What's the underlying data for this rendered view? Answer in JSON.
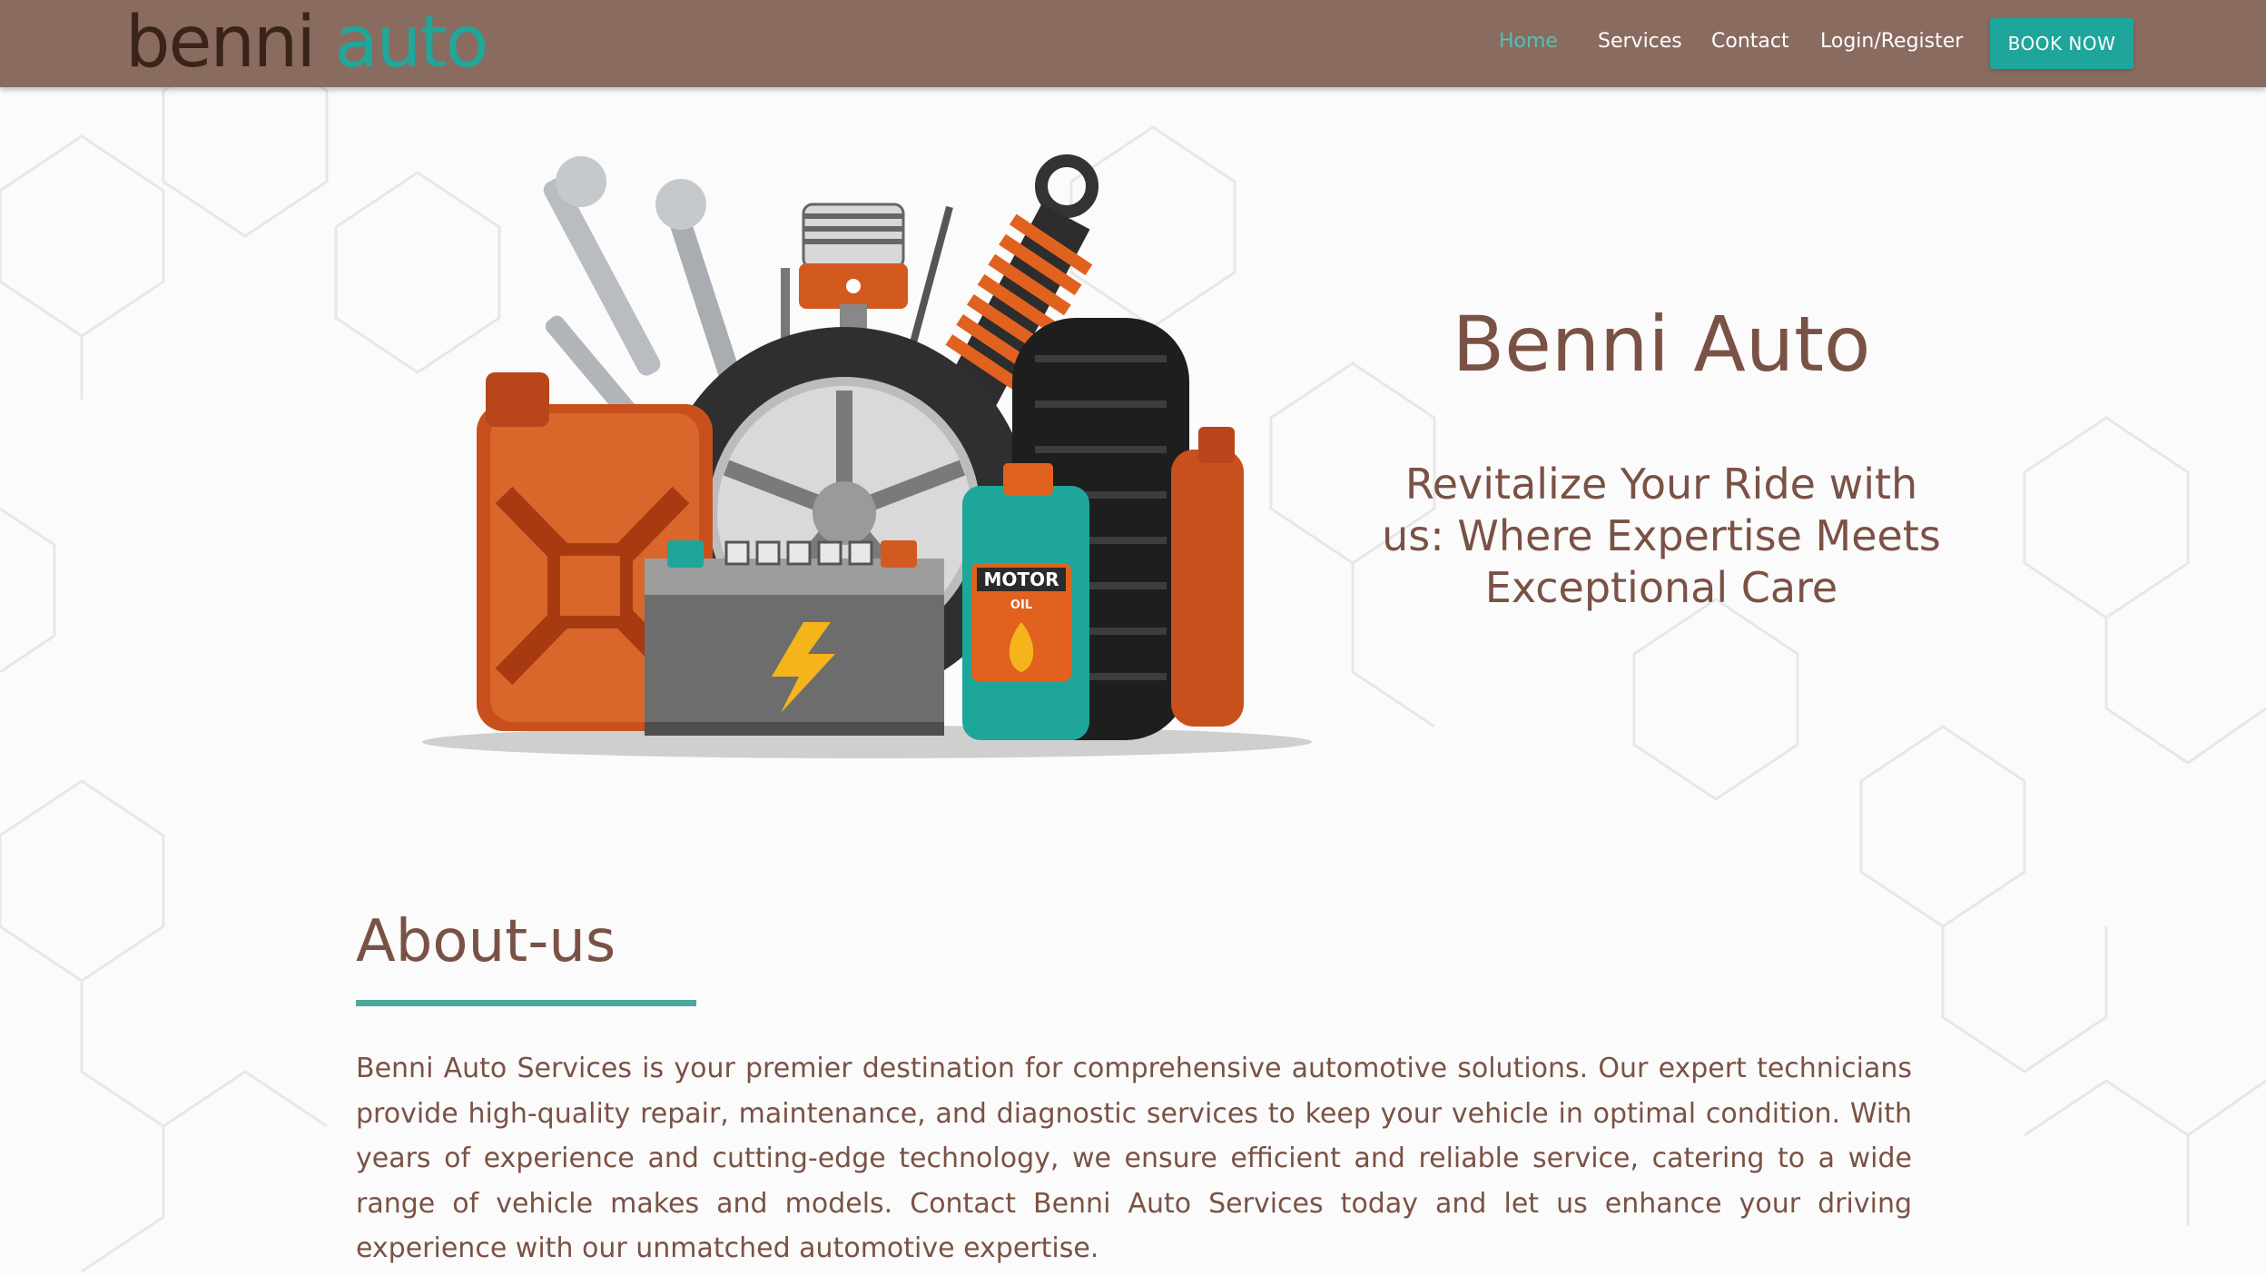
{
  "brand": {
    "logo_part1": "benni ",
    "logo_part2": "auto",
    "logo_color": "#3a2418",
    "logo_accent": "#1fa79a"
  },
  "nav": {
    "items": [
      {
        "label": "Home",
        "active": true
      },
      {
        "label": "Services",
        "active": false
      },
      {
        "label": "Contact",
        "active": false
      },
      {
        "label": "Login/Register",
        "active": false
      }
    ],
    "cta": "BOOK NOW"
  },
  "hero": {
    "title": "Benni Auto",
    "subtitle": "Revitalize Your Ride with us: Where Expertise Meets Exceptional Care",
    "illustration_icon": "auto-parts-illustration",
    "oil_label_1": "MOTOR",
    "oil_label_2": "OIL"
  },
  "about": {
    "title": "About-us",
    "text": "Benni Auto Services is your premier destination for comprehensive automotive solutions. Our expert technicians provide high-quality repair, maintenance, and diagnostic services to keep your vehicle in optimal condition. With years of experience and cutting-edge technology, we ensure efficient and reliable service, catering to a wide range of vehicle makes and models. Contact Benni Auto Services today and let us enhance your driving experience with our unmatched automotive expertise."
  },
  "colors": {
    "header_bg": "#8a6b60",
    "accent": "#1fa69a",
    "text_brown": "#7a5245",
    "active_nav": "#4fc3b5"
  }
}
